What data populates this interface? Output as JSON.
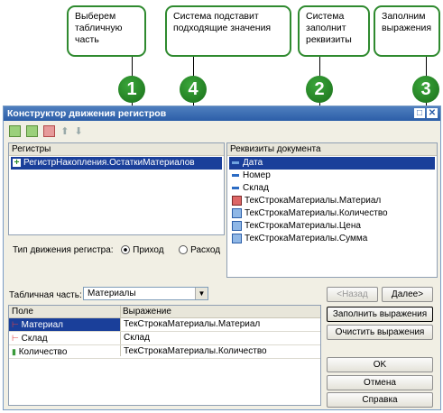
{
  "callouts": {
    "c1": "Выберем табличную часть",
    "c2": "Система заполнит реквизиты",
    "c3": "Заполним выражения",
    "c4": "Система подставит подходящие значения"
  },
  "badges": {
    "b1": "1",
    "b2": "2",
    "b3": "3",
    "b4": "4"
  },
  "window": {
    "title": "Конструктор движения регистров",
    "registers_header": "Регистры",
    "register_item": "РегистрНакопления.ОстаткиМатериалов",
    "movement_type_label": "Тип движения регистра:",
    "radio_in": "Приход",
    "radio_out": "Расход",
    "doc_requisites_header": "Реквизиты документа",
    "requisites": [
      "Дата",
      "Номер",
      "Склад",
      "ТекСтрокаМатериалы.Материал",
      "ТекСтрокаМатериалы.Количество",
      "ТекСтрокаМатериалы.Цена",
      "ТекСтрокаМатериалы.Сумма"
    ],
    "table_part_label": "Табличная часть:",
    "table_part_value": "Материалы",
    "grid_headers": [
      "Поле",
      "Выражение"
    ],
    "grid_rows": [
      {
        "field": "Материал",
        "expr": "ТекСтрокаМатериалы.Материал"
      },
      {
        "field": "Склад",
        "expr": "Склад"
      },
      {
        "field": "Количество",
        "expr": "ТекСтрокаМатериалы.Количество"
      }
    ],
    "buttons": {
      "back": "<Назад",
      "next": "Далее>",
      "fill": "Заполнить выражения",
      "clear": "Очистить выражения",
      "ok": "OK",
      "cancel": "Отмена",
      "help": "Справка"
    }
  },
  "colors": {
    "accent": "#2f8a2f",
    "selection": "#1a3f9a",
    "title": "#2c5ea8"
  }
}
